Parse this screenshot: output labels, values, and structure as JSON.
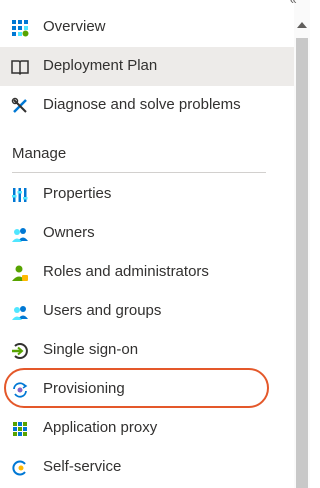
{
  "nav": {
    "top_items": [
      {
        "label": "Overview",
        "icon": "overview-grid-icon"
      },
      {
        "label": "Deployment Plan",
        "icon": "book-icon"
      },
      {
        "label": "Diagnose and solve problems",
        "icon": "wrench-icon"
      }
    ],
    "section_header": "Manage",
    "manage_items": [
      {
        "label": "Properties",
        "icon": "properties-bars-icon"
      },
      {
        "label": "Owners",
        "icon": "users-icon"
      },
      {
        "label": "Roles and administrators",
        "icon": "user-role-icon"
      },
      {
        "label": "Users and groups",
        "icon": "users-icon"
      },
      {
        "label": "Single sign-on",
        "icon": "sso-icon"
      },
      {
        "label": "Provisioning",
        "icon": "provisioning-icon"
      },
      {
        "label": "Application proxy",
        "icon": "app-proxy-icon"
      },
      {
        "label": "Self-service",
        "icon": "self-service-icon"
      }
    ]
  },
  "colors": {
    "active_bg": "#edebe9",
    "highlight_ring": "#e4582a",
    "icon_blue": "#0078d4",
    "icon_green": "#57a300"
  },
  "collapse_glyph": "«"
}
